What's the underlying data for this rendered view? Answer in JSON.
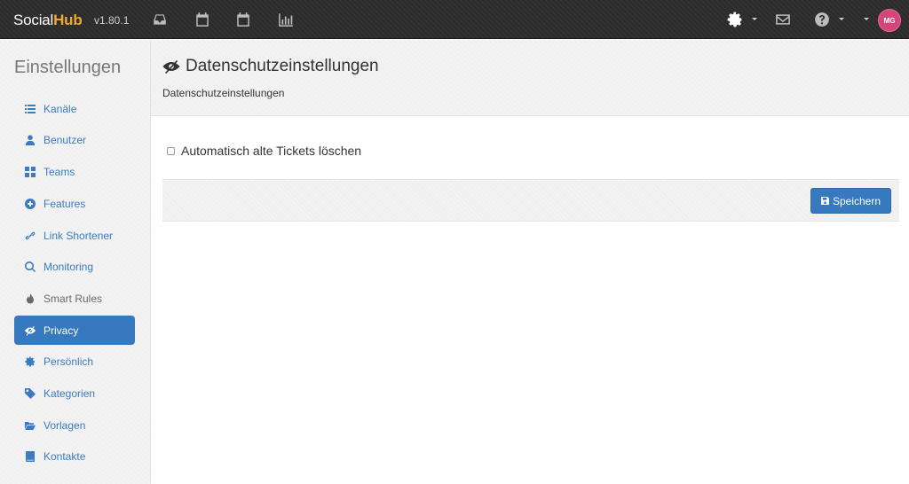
{
  "topbar": {
    "brand_social": "Social",
    "brand_hub": "Hub",
    "version": "v1.80.1",
    "icons": [
      "inbox-icon",
      "calendar-icon",
      "calendar-icon",
      "bar-chart-icon",
      "gear-icon",
      "envelope-icon",
      "question-icon"
    ],
    "avatar_initials": "MG",
    "avatar_color": "#d6457a",
    "brand_accent": "#f0a92e"
  },
  "sidebar": {
    "title": "Einstellungen",
    "items": [
      {
        "label": "Kanäle",
        "icon": "list-icon"
      },
      {
        "label": "Benutzer",
        "icon": "user-icon"
      },
      {
        "label": "Teams",
        "icon": "grid-icon"
      },
      {
        "label": "Features",
        "icon": "plus-circle-icon"
      },
      {
        "label": "Link Shortener",
        "icon": "link-icon"
      },
      {
        "label": "Monitoring",
        "icon": "search-icon"
      },
      {
        "label": "Smart Rules",
        "icon": "fire-icon"
      },
      {
        "label": "Privacy",
        "icon": "eye-slash-icon",
        "active": true
      },
      {
        "label": "Persönlich",
        "icon": "gear-icon"
      },
      {
        "label": "Kategorien",
        "icon": "tag-icon"
      },
      {
        "label": "Vorlagen",
        "icon": "folder-open-icon"
      },
      {
        "label": "Kontakte",
        "icon": "book-icon"
      }
    ],
    "active_color": "#3679be"
  },
  "main": {
    "title": "Datenschutzeinstellungen",
    "subtitle": "Datenschutzeinstellungen",
    "checkbox_label": "Automatisch alte Tickets löschen",
    "checkbox_checked": false,
    "save_label": "Speichern"
  }
}
